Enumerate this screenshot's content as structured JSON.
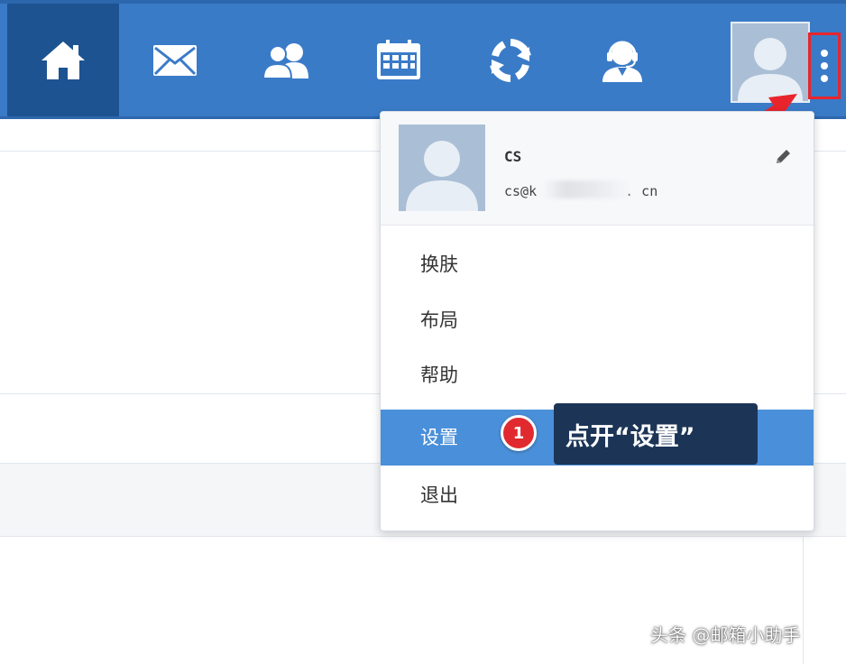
{
  "nav": {
    "items": [
      {
        "icon": "home-icon",
        "active": true
      },
      {
        "icon": "mail-icon"
      },
      {
        "icon": "contacts-icon"
      },
      {
        "icon": "calendar-icon"
      },
      {
        "icon": "sync-icon"
      },
      {
        "icon": "support-agent-icon"
      }
    ],
    "avatar_icon": "user-avatar-icon",
    "more_icon": "more-vertical-icon"
  },
  "dropdown": {
    "user": {
      "name": "CS",
      "email_prefix": "cs@k",
      "email_suffix": ". cn"
    },
    "edit_icon": "pencil-icon",
    "menu": [
      {
        "label": "换肤"
      },
      {
        "label": "布局"
      },
      {
        "label": "帮助"
      },
      {
        "label": "设置",
        "selected": true
      },
      {
        "label": "退出"
      }
    ]
  },
  "annotation": {
    "step_number": "1",
    "callout_text": "点开“设置”"
  },
  "watermark": "头条 @邮箱小助手",
  "colors": {
    "topbar": "#3a7bc8",
    "topbar_active": "#1e5391",
    "selected_item": "#4a8fd9",
    "highlight_red": "#e8252c",
    "callout_bg": "#1c3557"
  }
}
